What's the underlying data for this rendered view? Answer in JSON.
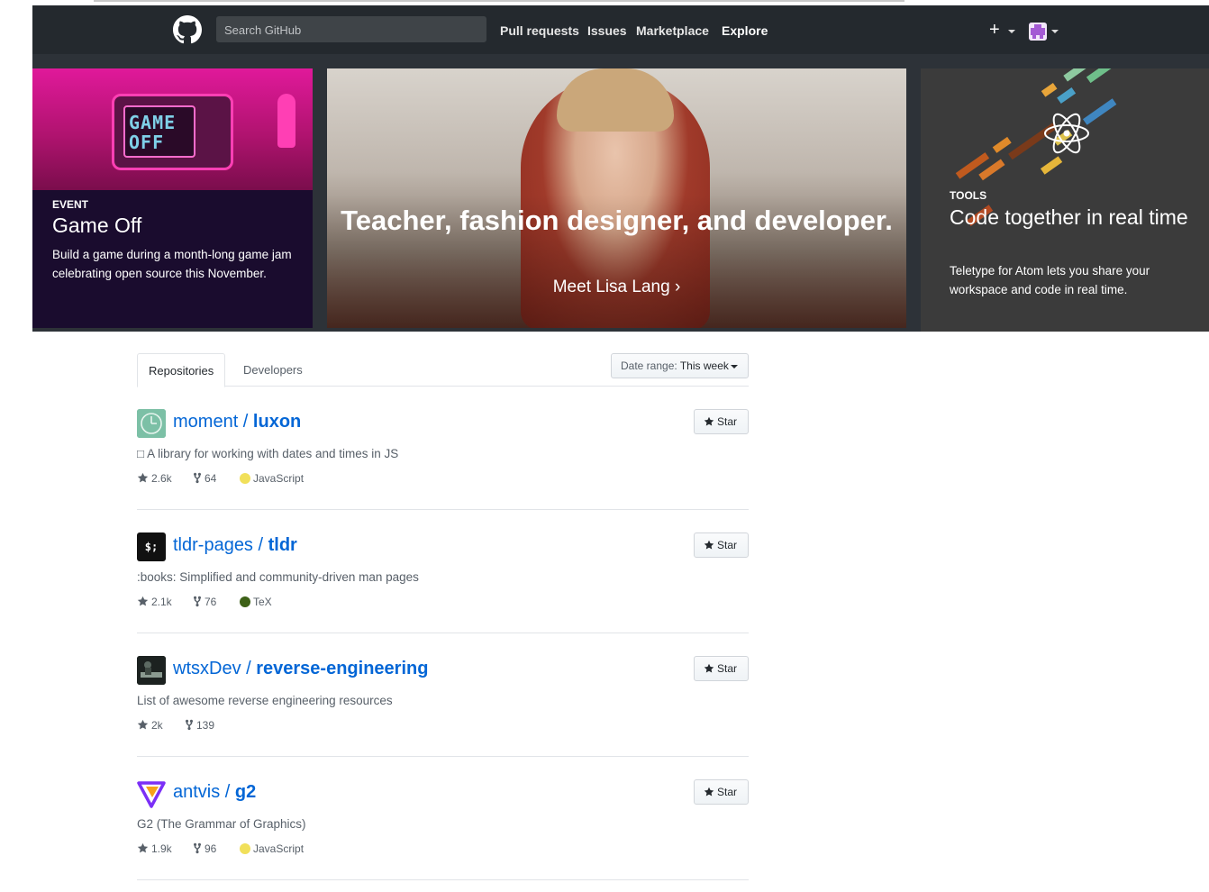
{
  "header": {
    "search_placeholder": "Search GitHub",
    "nav": [
      "Pull requests",
      "Issues",
      "Marketplace",
      "Explore"
    ],
    "plus_glyph": "+",
    "icons": [
      "github-logo-icon",
      "plus-icon",
      "avatar"
    ]
  },
  "banner": {
    "game_off": {
      "label": "EVENT",
      "title": "Game Off",
      "description": "Build a game during a month-long game jam celebrating open source this November.",
      "monitor_text": "GAME\nOFF"
    },
    "feature": {
      "title": "Teacher, fashion designer, and developer.",
      "link": "Meet Lisa Lang",
      "link_arrow": "›"
    },
    "tools": {
      "label": "TOOLS",
      "title": "Code together in real time",
      "description": "Teletype for Atom lets you share your workspace and code in real time."
    }
  },
  "tabs": {
    "items": [
      "Repositories",
      "Developers"
    ],
    "active": "Repositories"
  },
  "date_range": {
    "label": "Date range:",
    "value": "This week"
  },
  "repos": [
    {
      "owner": "moment",
      "sep": " / ",
      "name": "luxon",
      "description": "□ A library for working with dates and times in JS",
      "stars": "2.6k",
      "forks": "64",
      "language": "JavaScript",
      "language_color": "#f1e05a",
      "star_label": "Star"
    },
    {
      "owner": "tldr-pages",
      "sep": " / ",
      "name": "tldr",
      "description": ":books: Simplified and community-driven man pages",
      "stars": "2.1k",
      "forks": "76",
      "language": "TeX",
      "language_color": "#3D6117",
      "star_label": "Star",
      "icon_text": "$;"
    },
    {
      "owner": "wtsxDev",
      "sep": " / ",
      "name": "reverse-engineering",
      "description": "List of awesome reverse engineering resources",
      "stars": "2k",
      "forks": "139",
      "language": "",
      "star_label": "Star"
    },
    {
      "owner": "antvis",
      "sep": " / ",
      "name": "g2",
      "description": "G2 (The Grammar of Graphics)",
      "stars": "1.9k",
      "forks": "96",
      "language": "JavaScript",
      "language_color": "#f1e05a",
      "star_label": "Star"
    }
  ],
  "colors": {
    "header_bg": "#24292e",
    "link": "#0366d6",
    "muted": "#586069"
  }
}
